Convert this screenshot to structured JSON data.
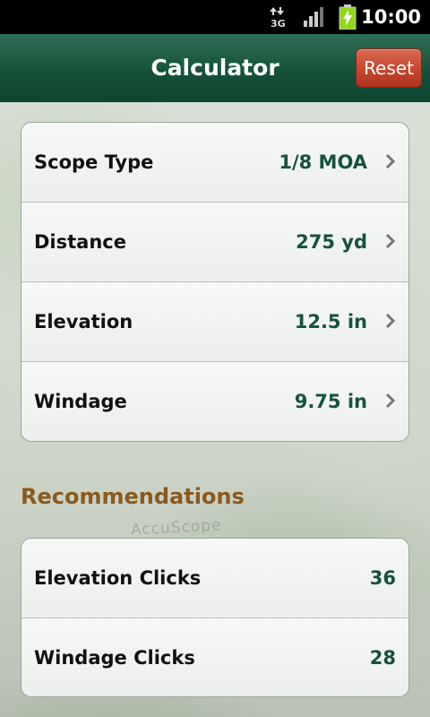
{
  "status_bar": {
    "network": "3G",
    "time": "10:00"
  },
  "header": {
    "title": "Calculator",
    "reset_label": "Reset"
  },
  "settings": [
    {
      "label": "Scope Type",
      "value": "1/8 MOA"
    },
    {
      "label": "Distance",
      "value": "275 yd"
    },
    {
      "label": "Elevation",
      "value": "12.5 in"
    },
    {
      "label": "Windage",
      "value": "9.75 in"
    }
  ],
  "recommendations": {
    "title": "Recommendations",
    "items": [
      {
        "label": "Elevation Clicks",
        "value": "36"
      },
      {
        "label": "Windage Clicks",
        "value": "28"
      }
    ]
  },
  "background": {
    "watermark": "AccuScope"
  },
  "colors": {
    "header_green": "#155239",
    "reset_red": "#c8482f",
    "value_green": "#15533b",
    "section_brown": "#8a5a1e"
  },
  "icons": [
    "3g-data-icon",
    "signal-icon",
    "battery-charging-icon",
    "chevron-right-icon"
  ]
}
